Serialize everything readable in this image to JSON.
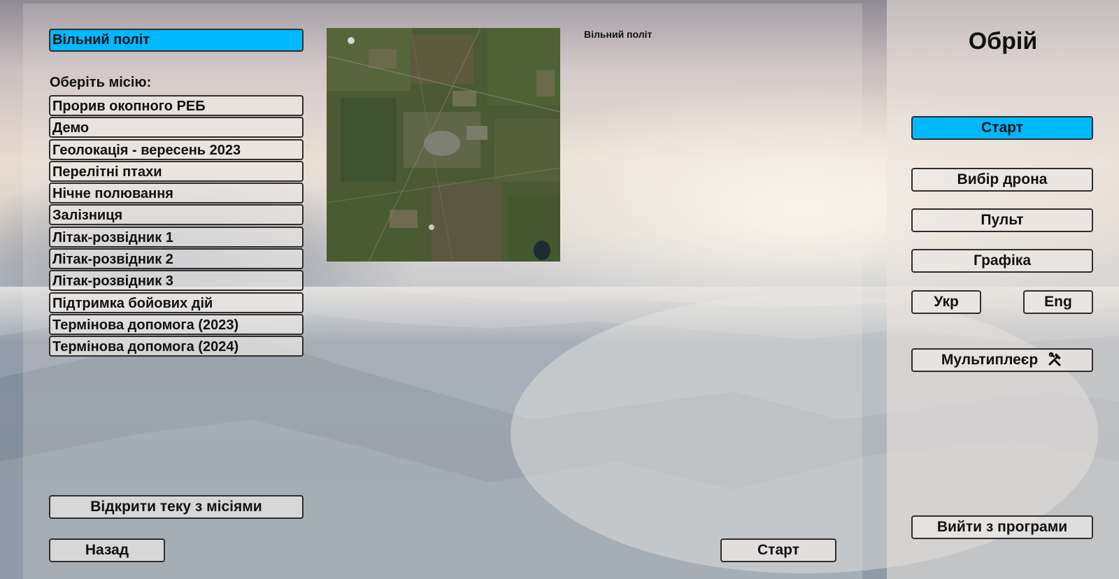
{
  "app": {
    "title": "Обрій"
  },
  "mission_select": {
    "selected_mission": "Вільний політ",
    "prompt": "Оберіть місію:",
    "missions": [
      "Прорив окопного РЕБ",
      "Демо",
      "Геолокація - вересень 2023",
      "Перелітні птахи",
      "Нічне полювання",
      "Залізниця",
      "Літак-розвідник 1",
      "Літак-розвідник 2",
      "Літак-розвідник 3",
      "Підтримка бойових дій",
      "Термінова допомога (2023)",
      "Термінова допомога (2024)"
    ],
    "preview_caption": "Вільний політ",
    "open_folder_label": "Відкрити теку з місіями",
    "back_label": "Назад",
    "start_label": "Старт"
  },
  "main_menu": {
    "start_label": "Старт",
    "drone_select_label": "Вибір дрона",
    "remote_label": "Пульт",
    "graphics_label": "Графіка",
    "lang_ukr_label": "Укр",
    "lang_eng_label": "Eng",
    "multiplayer_label": "Мультиплеєр",
    "multiplayer_icon": "tools-icon",
    "exit_label": "Вийти з програми"
  },
  "colors": {
    "selected": "#00b8ff",
    "button_border": "#2e2e2e",
    "text": "#111111"
  }
}
